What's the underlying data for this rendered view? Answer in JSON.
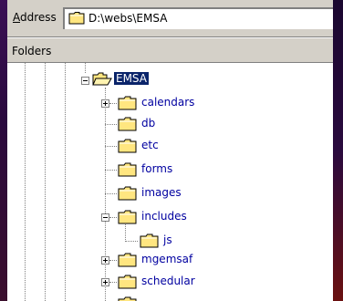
{
  "address": {
    "label": "Address",
    "path": "D:\\webs\\EMSA"
  },
  "folders_header": {
    "label": "Folders"
  },
  "tree": {
    "root": {
      "label": "EMSA",
      "icon": "open-folder-icon",
      "expanded": true,
      "selected": true
    },
    "children": [
      {
        "label": "calendars",
        "icon": "folder-icon",
        "expander": "plus"
      },
      {
        "label": "db",
        "icon": "folder-icon"
      },
      {
        "label": "etc",
        "icon": "folder-icon"
      },
      {
        "label": "forms",
        "icon": "folder-icon"
      },
      {
        "label": "images",
        "icon": "folder-icon"
      },
      {
        "label": "includes",
        "icon": "folder-icon",
        "expander": "minus",
        "children": [
          {
            "label": "js",
            "icon": "folder-icon"
          }
        ]
      },
      {
        "label": "mgemsaf",
        "icon": "folder-icon",
        "expander": "plus"
      },
      {
        "label": "schedular",
        "icon": "folder-icon",
        "expander": "plus"
      }
    ]
  },
  "colors": {
    "window_face": "#d4d0c8",
    "selection": "#0a246a",
    "folder_yellow": "#ffe680",
    "tree_text": "#0000a0",
    "desktop": "#2a0a3e"
  }
}
